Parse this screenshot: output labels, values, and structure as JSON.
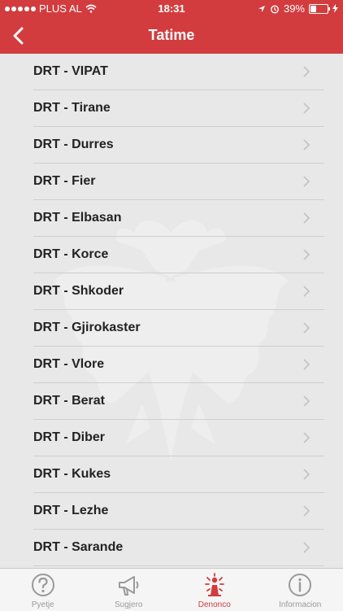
{
  "status": {
    "carrier": "PLUS AL",
    "time": "18:31",
    "battery": "39%",
    "battery_level": 0.39
  },
  "nav": {
    "title": "Tatime",
    "back_icon": "chevron-left-icon"
  },
  "items": [
    {
      "label": "DRT - VIPAT"
    },
    {
      "label": "DRT - Tirane"
    },
    {
      "label": "DRT - Durres"
    },
    {
      "label": "DRT - Fier"
    },
    {
      "label": "DRT - Elbasan"
    },
    {
      "label": "DRT - Korce"
    },
    {
      "label": "DRT - Shkoder"
    },
    {
      "label": "DRT - Gjirokaster"
    },
    {
      "label": "DRT - Vlore"
    },
    {
      "label": "DRT - Berat"
    },
    {
      "label": "DRT - Diber"
    },
    {
      "label": "DRT - Kukes"
    },
    {
      "label": "DRT - Lezhe"
    },
    {
      "label": "DRT - Sarande"
    }
  ],
  "tabs": [
    {
      "label": "Pyetje",
      "icon": "question-icon",
      "active": false
    },
    {
      "label": "Sugjero",
      "icon": "megaphone-icon",
      "active": false
    },
    {
      "label": "Denonco",
      "icon": "alert-person-icon",
      "active": true
    },
    {
      "label": "Informacion",
      "icon": "info-icon",
      "active": false
    }
  ],
  "colors": {
    "accent": "#d23c3e",
    "background": "#e8e8e8",
    "tab_inactive": "#9a9a9a"
  }
}
